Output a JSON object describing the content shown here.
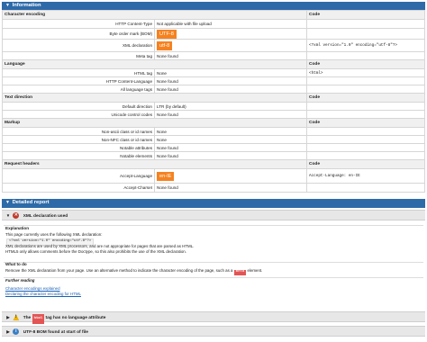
{
  "information": {
    "title": "Information",
    "sections": [
      {
        "heading": "Character encoding",
        "code_heading": "Code",
        "rows": [
          {
            "label": "HTTP Content-Type",
            "value": "Not applicable with file upload",
            "code": ""
          },
          {
            "label": "Byte order mark (BOM)",
            "chip": "UTF-8",
            "code": ""
          },
          {
            "label": "XML declaration",
            "chip": "utf-8",
            "code": "<?xml version=\"1.0\" encoding=\"utf-8\"?>"
          },
          {
            "label": "Meta tag",
            "value": "None found",
            "code": ""
          }
        ]
      },
      {
        "heading": "Language",
        "code_heading": "Code",
        "rows": [
          {
            "label": "HTML tag",
            "value": "None",
            "code": "<html>"
          },
          {
            "label": "HTTP Content-Language",
            "value": "None found",
            "code": ""
          },
          {
            "label": "All language tags",
            "value": "None found",
            "code": ""
          }
        ]
      },
      {
        "heading": "Text direction",
        "code_heading": "Code",
        "rows": [
          {
            "label": "Default direction",
            "value": "LTR (by default)",
            "code": ""
          },
          {
            "label": "Unicode control codes",
            "value": "None found",
            "code": ""
          }
        ]
      },
      {
        "heading": "Markup",
        "code_heading": "Code",
        "rows": [
          {
            "label": "Non-ascii class or id names",
            "value": "None",
            "code": ""
          },
          {
            "label": "Non-NFC class or id names",
            "value": "None",
            "code": ""
          },
          {
            "label": "Notable attributes",
            "value": "None found",
            "code": ""
          },
          {
            "label": "Notable elements",
            "value": "None found",
            "code": ""
          }
        ]
      },
      {
        "heading": "Request headers",
        "code_heading": "Code",
        "rows": [
          {
            "label": "Accept-Language",
            "chip": "en-IE",
            "code": "Accept-Language: en-IE"
          },
          {
            "label": "Accept-Charset",
            "value": "None found",
            "code": ""
          }
        ]
      }
    ]
  },
  "detailed_report": {
    "title": "Detailed report",
    "issue1": {
      "toggle": "▼",
      "title": "XML declaration used",
      "explanation_heading": "Explanation",
      "line1": "This page currently uses the following XML declaration:",
      "code_line": "<?xml version=\"1.0\" encoding=\"utf-8\"?>",
      "line2": "XML declarations are used by XML processors, and are not appropriate for pages that are parsed as HTML.",
      "line3": "HTML5 only allows comments before the Doctype, so this also prohibits the use of the XML declaration.",
      "what_heading": "What to do",
      "what_text_a": "Remove the XML declaration from your page. Use an alternative method to indicate the character encoding of the page, such as a",
      "what_code": "meta",
      "what_text_b": "element.",
      "further_heading": "Further reading",
      "links": [
        "Character encodings explained",
        "Declaring the character encoding for HTML"
      ]
    },
    "issue2": {
      "toggle": "▶",
      "title_a": "The",
      "tag": "html",
      "title_b": "tag has no language attribute"
    },
    "issue3": {
      "toggle": "▶",
      "title": "UTF-8 BOM found at start of file"
    }
  }
}
